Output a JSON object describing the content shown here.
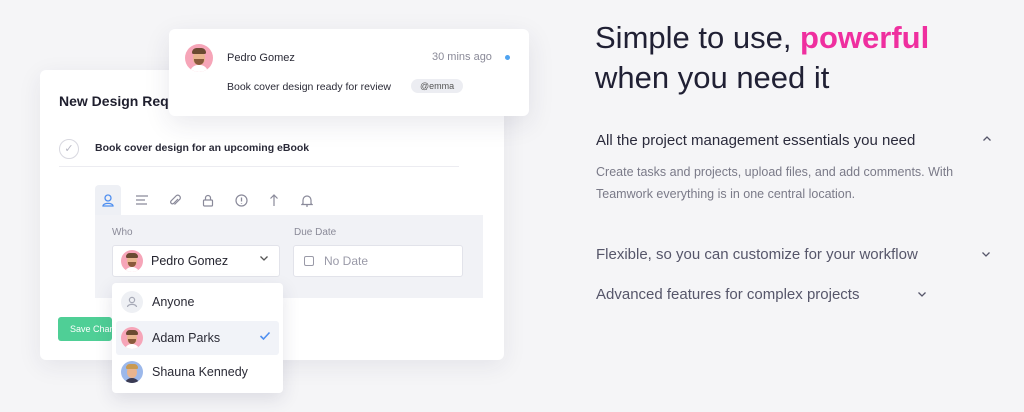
{
  "design_card": {
    "title": "New Design Request",
    "task": "Book cover design for an upcoming eBook",
    "who_label": "Who",
    "who_value": "Pedro Gomez",
    "due_label": "Due Date",
    "due_placeholder": "No Date",
    "save_label": "Save Changes"
  },
  "tabs": [
    "user-icon",
    "list-icon",
    "paperclip-icon",
    "lock-icon",
    "info-icon",
    "arrow-up-icon",
    "bell-icon"
  ],
  "dropdown": {
    "options": [
      {
        "name": "Anyone"
      },
      {
        "name": "Adam Parks",
        "selected": true
      },
      {
        "name": "Shauna Kennedy"
      }
    ]
  },
  "notification": {
    "name": "Pedro Gomez",
    "time": "30 mins ago",
    "message": "Book cover design ready for review",
    "mention": "@emma"
  },
  "headline": {
    "part1": "Simple to use, ",
    "highlight": "powerful",
    "part2": "when you need it"
  },
  "accordion": [
    {
      "title": "All the project management essentials you need",
      "expanded": true,
      "body": "Create tasks and projects, upload files, and add comments. With Teamwork everything is in one central location."
    },
    {
      "title": "Flexible, so you can customize for your workflow",
      "expanded": false
    },
    {
      "title": "Advanced features for complex projects",
      "expanded": false
    }
  ],
  "colors": {
    "accent_pink": "#ef2f9f",
    "accent_blue": "#4f8ff0",
    "save_green": "#4fcf96",
    "background": "#f5f5f7"
  }
}
